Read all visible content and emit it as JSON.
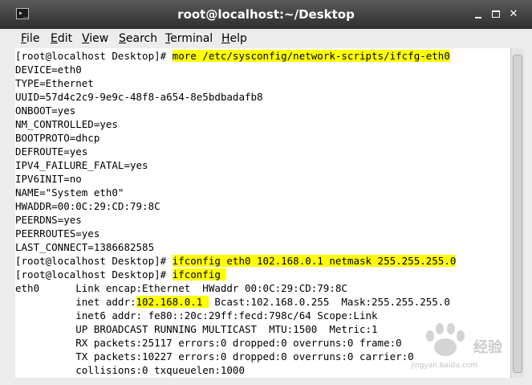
{
  "window": {
    "title": "root@localhost:~/Desktop",
    "app_icon": "terminal-icon",
    "app_icon_glyph": "▸_"
  },
  "menu": {
    "items": [
      {
        "label_mnemonic": "F",
        "label_rest": "ile"
      },
      {
        "label_mnemonic": "E",
        "label_rest": "dit"
      },
      {
        "label_mnemonic": "V",
        "label_rest": "iew"
      },
      {
        "label_mnemonic": "S",
        "label_rest": "earch"
      },
      {
        "label_mnemonic": "T",
        "label_rest": "erminal"
      },
      {
        "label_mnemonic": "H",
        "label_rest": "elp"
      }
    ]
  },
  "terminal": {
    "lines": [
      {
        "prompt": "[root@localhost Desktop]# ",
        "cmd": "more /etc/sysconfig/network-scripts/ifcfg-eth0"
      },
      {
        "text": "DEVICE=eth0"
      },
      {
        "text": "TYPE=Ethernet"
      },
      {
        "text": "UUID=57d4c2c9-9e9c-48f8-a654-8e5bdbadafb8"
      },
      {
        "text": "ONBOOT=yes"
      },
      {
        "text": "NM_CONTROLLED=yes"
      },
      {
        "text": "BOOTPROTO=dhcp"
      },
      {
        "text": "DEFROUTE=yes"
      },
      {
        "text": "IPV4_FAILURE_FATAL=yes"
      },
      {
        "text": "IPV6INIT=no"
      },
      {
        "text": "NAME=\"System eth0\""
      },
      {
        "text": "HWADDR=00:0C:29:CD:79:8C"
      },
      {
        "text": "PEERDNS=yes"
      },
      {
        "text": "PEERROUTES=yes"
      },
      {
        "text": "LAST_CONNECT=1386682585"
      },
      {
        "prompt": "[root@localhost Desktop]# ",
        "cmd": "ifconfig eth0 102.168.0.1 netmask 255.255.255.0"
      },
      {
        "prompt": "[root@localhost Desktop]# ",
        "cmd": "ifconfig "
      },
      {
        "text": "eth0      Link encap:Ethernet  HWaddr 00:0C:29:CD:79:8C"
      },
      {
        "pre": "          inet addr:",
        "hl": "102.168.0.1 ",
        "post": " Bcast:102.168.0.255  Mask:255.255.255.0"
      },
      {
        "text": "          inet6 addr: fe80::20c:29ff:fecd:798c/64 Scope:Link"
      },
      {
        "text": "          UP BROADCAST RUNNING MULTICAST  MTU:1500  Metric:1"
      },
      {
        "text": "          RX packets:25117 errors:0 dropped:0 overruns:0 frame:0"
      },
      {
        "text": "          TX packets:10227 errors:0 dropped:0 overruns:0 carrier:0"
      },
      {
        "text": "          collisions:0 txqueuelen:1000"
      }
    ]
  },
  "watermark": {
    "text": "经验",
    "sub": "jingyan.baidu.com",
    "icon": "paw-icon"
  },
  "colors": {
    "highlight": "#ffff00",
    "titlebar": "#3a3a3a"
  }
}
